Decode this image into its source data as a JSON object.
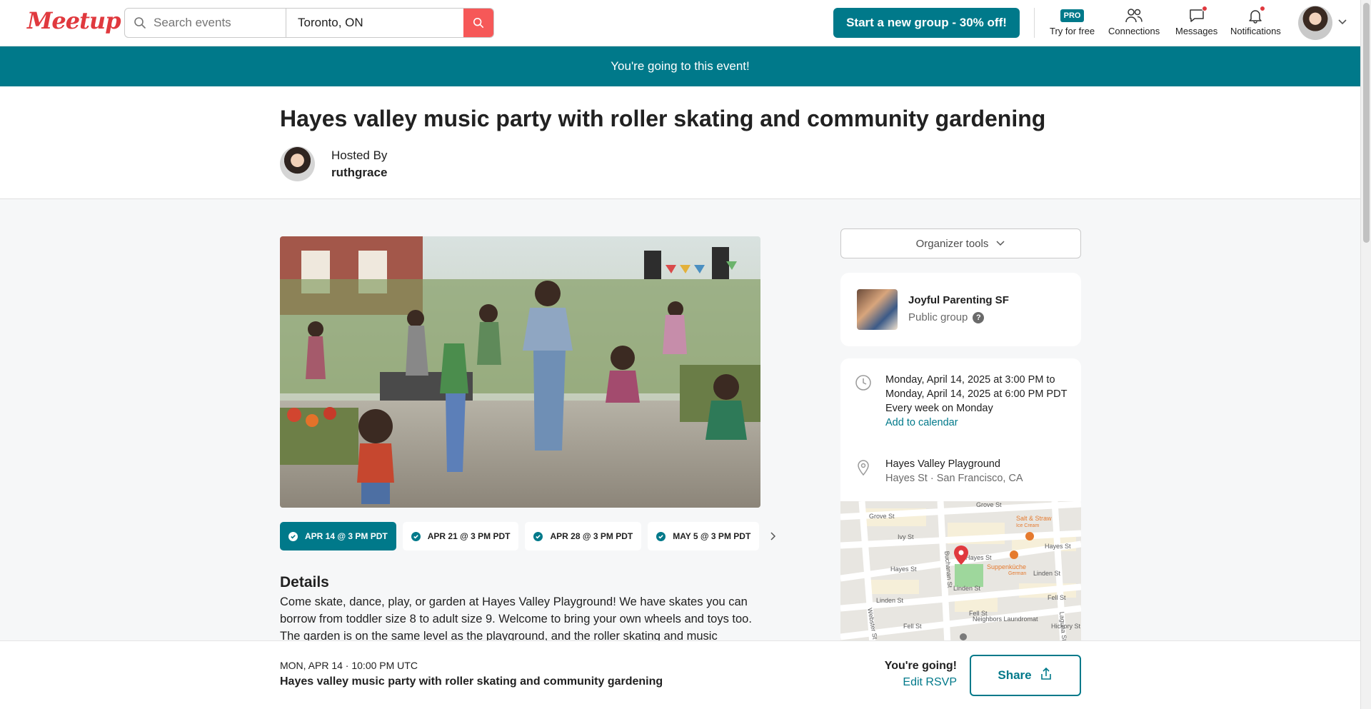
{
  "header": {
    "logo": "Meetup",
    "search_placeholder": "Search events",
    "location_value": "Toronto, ON",
    "new_group_label": "Start a new group - 30% off!",
    "pro_badge": "PRO",
    "nav": {
      "try_free": "Try for free",
      "connections": "Connections",
      "messages": "Messages",
      "notifications": "Notifications"
    }
  },
  "banner": {
    "text": "You're going to this event!"
  },
  "event": {
    "title": "Hayes valley music party with roller skating and community gardening",
    "hosted_by_label": "Hosted By",
    "host_name": "ruthgrace",
    "dates": [
      {
        "label": "APR 14 @ 3 PM PDT",
        "active": true
      },
      {
        "label": "APR 21 @ 3 PM PDT",
        "active": false
      },
      {
        "label": "APR 28 @ 3 PM PDT",
        "active": false
      },
      {
        "label": "MAY 5 @ 3 PM PDT",
        "active": false
      }
    ],
    "details_heading": "Details",
    "details_text": "Come skate, dance, play, or garden at Hayes Valley Playground! We have skates you can borrow from toddler size 8 to adult size 9. Welcome to bring your own wheels and toys too. The garden is on the same level as the playground, and the roller skating and music"
  },
  "sidebar": {
    "organizer_tools": "Organizer tools",
    "group_name": "Joyful Parenting SF",
    "group_type": "Public group",
    "group_help": "?",
    "time_text": "Monday, April 14, 2025 at 3:00 PM to Monday, April 14, 2025 at 6:00 PM PDT",
    "recurrence": "Every week on Monday",
    "add_calendar": "Add to calendar",
    "venue_name": "Hayes Valley Playground",
    "venue_address": "Hayes St · San Francisco, CA",
    "map_labels": {
      "grove_st": "Grove St",
      "ivy_st": "Ivy St",
      "hayes_st": "Hayes St",
      "linden_st": "Linden St",
      "fell_st": "Fell St",
      "webster_st": "Webster St",
      "buchanan_st": "Buchanan St",
      "laguna_st": "Laguna St",
      "hickory_st": "Hickory St",
      "salt_straw": "Salt & Straw",
      "salt_straw_sub": "Ice Cream",
      "suppenkuche": "Suppenküche",
      "suppenkuche_sub": "German",
      "neighbors": "Neighbors Laundromat"
    }
  },
  "bottombar": {
    "date": "MON, APR 14 · 10:00 PM UTC",
    "title": "Hayes valley music party with roller skating and community gardening",
    "going": "You're going!",
    "edit_rsvp": "Edit RSVP",
    "share": "Share"
  },
  "colors": {
    "brand_teal": "#00798a",
    "brand_red": "#e0393e",
    "search_red": "#f65858"
  }
}
